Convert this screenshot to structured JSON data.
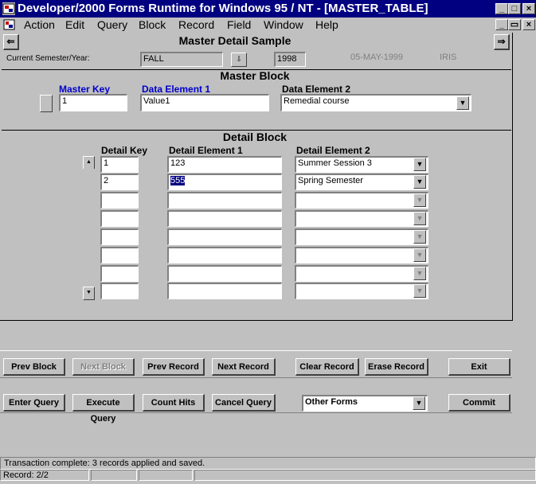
{
  "window": {
    "title": "Developer/2000 Forms Runtime for Windows 95 / NT - [MASTER_TABLE]",
    "app_icon": "forms-app-icon",
    "controls": {
      "minimize": "_",
      "restore": "□",
      "close": "×"
    },
    "doc_controls": {
      "minimize": "_",
      "restore": "▭",
      "close": "×"
    }
  },
  "menu": [
    "Action",
    "Edit",
    "Query",
    "Block",
    "Record",
    "Field",
    "Window",
    "Help"
  ],
  "header": {
    "title": "Master Detail Sample",
    "semester_label": "Current Semester/Year:",
    "semester_value": "FALL",
    "year_value": "1998",
    "date_value": "05-MAY-1999",
    "user_value": "IRIS"
  },
  "master": {
    "title": "Master Block",
    "key_label": "Master Key",
    "elem1_label": "Data Element 1",
    "elem2_label": "Data Element 2",
    "key_value": "1",
    "elem1_value": "Value1",
    "elem2_value": "Remedial course"
  },
  "detail": {
    "title": "Detail Block",
    "key_label": "Detail Key",
    "elem1_label": "Detail Element 1",
    "elem2_label": "Detail Element 2",
    "rows": [
      {
        "key": "1",
        "elem1": "123",
        "elem2": "Summer Session 3"
      },
      {
        "key": "2",
        "elem1": "555",
        "elem2": "Spring Semester"
      },
      {
        "key": "",
        "elem1": "",
        "elem2": ""
      },
      {
        "key": "",
        "elem1": "",
        "elem2": ""
      },
      {
        "key": "",
        "elem1": "",
        "elem2": ""
      },
      {
        "key": "",
        "elem1": "",
        "elem2": ""
      },
      {
        "key": "",
        "elem1": "",
        "elem2": ""
      },
      {
        "key": "",
        "elem1": "",
        "elem2": ""
      }
    ]
  },
  "buttons": {
    "prev_block": "Prev Block",
    "next_block": "Next Block",
    "prev_record": "Prev Record",
    "next_record": "Next Record",
    "clear_record": "Clear Record",
    "erase_record": "Erase Record",
    "exit": "Exit",
    "enter_query": "Enter Query",
    "execute_query": "Execute Query",
    "count_hits": "Count Hits",
    "cancel_query": "Cancel Query",
    "other_forms": "Other Forms",
    "commit": "Commit"
  },
  "status": {
    "message": "Transaction complete: 3 records applied and saved.",
    "record": "Record: 2/2"
  }
}
